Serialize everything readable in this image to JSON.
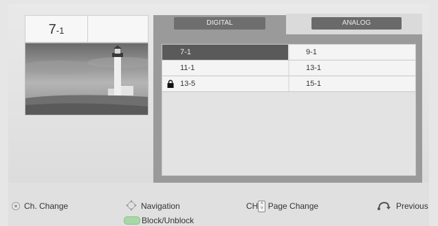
{
  "current_channel": {
    "main": "7",
    "sub": "-1"
  },
  "tabs": {
    "digital": "DIGITAL",
    "analog": "ANALOG"
  },
  "channels": [
    {
      "left": "7-1",
      "right": "9-1",
      "left_selected": true,
      "left_locked": false
    },
    {
      "left": "11-1",
      "right": "13-1",
      "left_selected": false,
      "left_locked": false
    },
    {
      "left": "13-5",
      "right": "15-1",
      "left_selected": false,
      "left_locked": true
    }
  ],
  "footer": {
    "ch_change": "Ch. Change",
    "navigation": "Navigation",
    "ch_prefix": "CH",
    "page_change": "Page Change",
    "previous": "Previous",
    "block_unblock": "Block/Unblock"
  },
  "icons": {
    "ok": "ok-button-icon",
    "nav": "navigation-arrows-icon",
    "ch_updown": "channel-up-down-icon",
    "previous": "return-icon",
    "green": "green-key-icon",
    "lock": "lock-icon"
  },
  "colors": {
    "selected_row": "#5a5a5a",
    "green_key": "#a8d8a8"
  }
}
